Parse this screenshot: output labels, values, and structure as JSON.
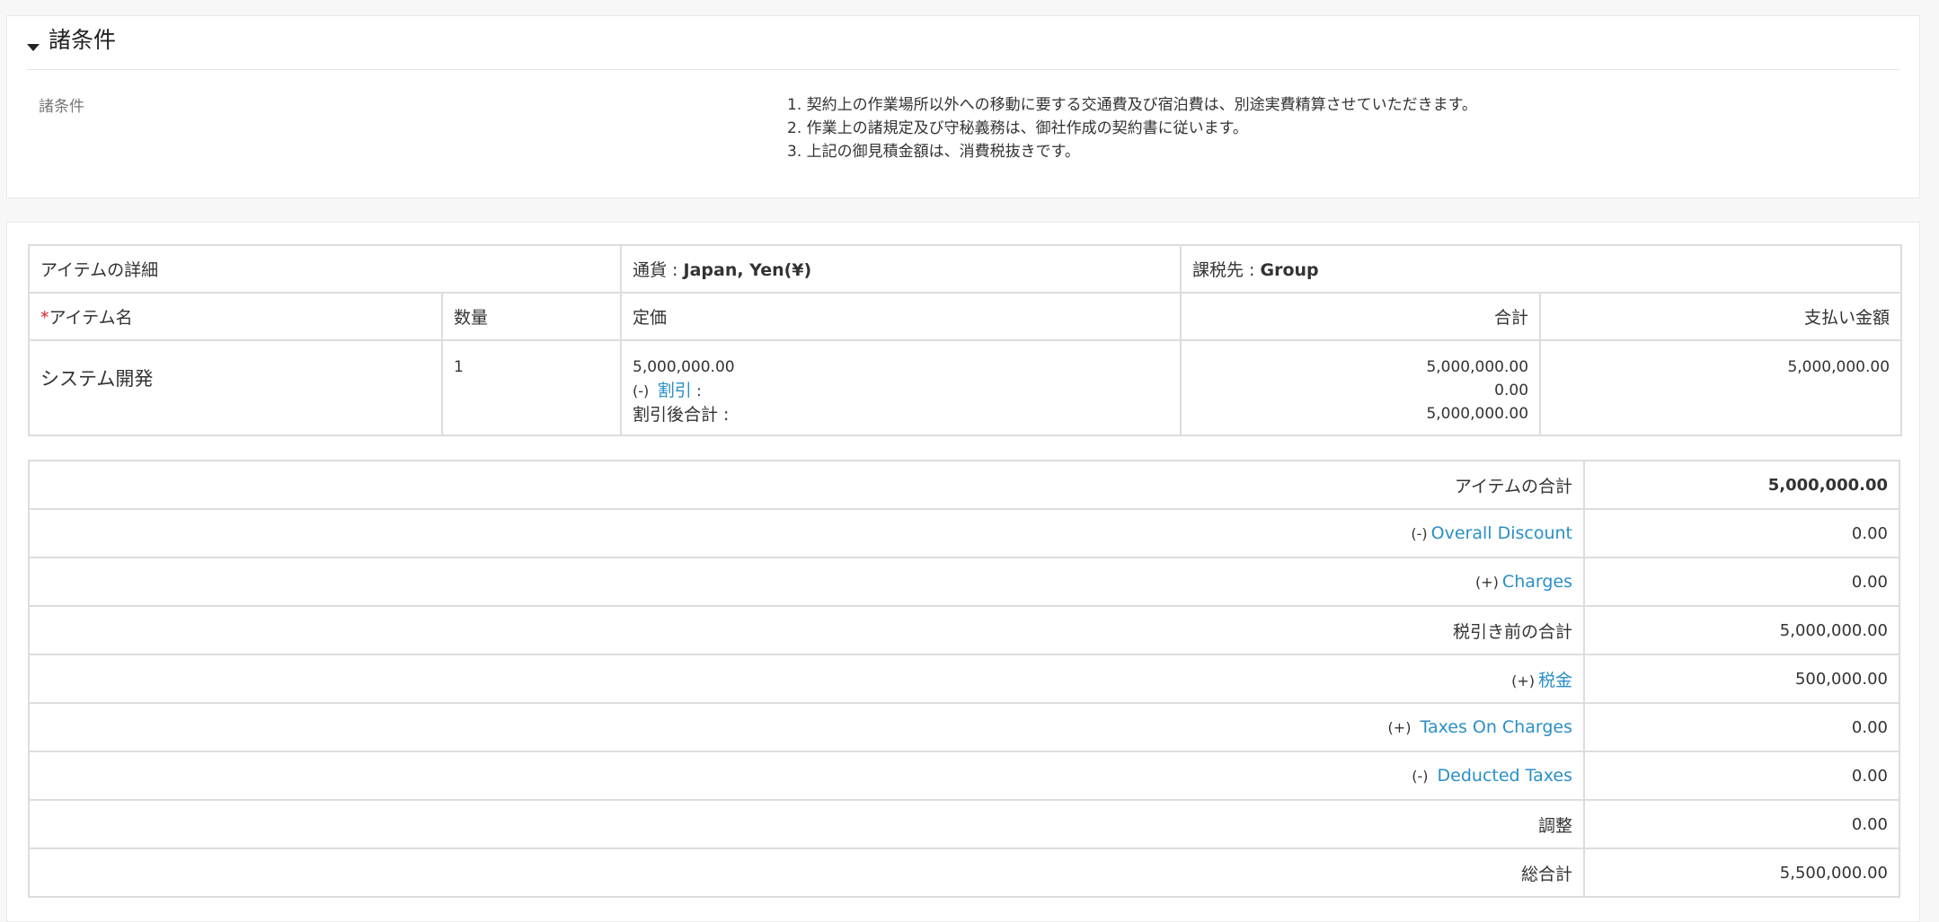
{
  "terms_section": {
    "title": "諸条件",
    "label": "諸条件",
    "items": [
      "1. 契約上の作業場所以外への移動に要する交通費及び宿泊費は、別途実費精算させていただきます。",
      "2. 作業上の諸規定及び守秘義務は、御社作成の契約書に従います。",
      "3. 上記の御見積金額は、消費税抜きです。"
    ]
  },
  "item_details": {
    "header": {
      "title": "アイテムの詳細",
      "currency_label": "通貨 :",
      "currency_value": "Japan, Yen(¥)",
      "tax_label": "課税先 :",
      "tax_value": "Group"
    },
    "columns": {
      "required_mark": "*",
      "item_name": "アイテム名",
      "quantity": "数量",
      "list_price": "定価",
      "total": "合計",
      "net_price": "支払い金額"
    },
    "rows": [
      {
        "name": "システム開発",
        "quantity": "1",
        "list_price": "5,000,000.00",
        "discount_prefix": "(-)",
        "discount_link": "割引",
        "discount_colon": ":",
        "after_discount_label": "割引後合計 :",
        "total": "5,000,000.00",
        "discount_amount": "0.00",
        "after_discount_total": "5,000,000.00",
        "net_price": "5,000,000.00"
      }
    ]
  },
  "totals": {
    "items_total_label": "アイテムの合計",
    "items_total": "5,000,000.00",
    "overall_discount_prefix": "(-)",
    "overall_discount_label": "Overall Discount",
    "overall_discount": "0.00",
    "charges_prefix": "(+)",
    "charges_label": "Charges",
    "charges": "0.00",
    "pre_tax_total_label": "税引き前の合計",
    "pre_tax_total": "5,000,000.00",
    "tax_prefix": "(+)",
    "tax_label": "税金",
    "tax": "500,000.00",
    "taxes_on_charges_prefix": "(+)",
    "taxes_on_charges_label": "Taxes On Charges",
    "taxes_on_charges": "0.00",
    "deducted_taxes_prefix": "(-)",
    "deducted_taxes_label": "Deducted Taxes",
    "deducted_taxes": "0.00",
    "adjustment_label": "調整",
    "adjustment": "0.00",
    "grand_total_label": "総合計",
    "grand_total": "5,500,000.00"
  },
  "colors": {
    "link": "#2a8fc7",
    "required": "#e02020",
    "border": "#dddddd"
  }
}
